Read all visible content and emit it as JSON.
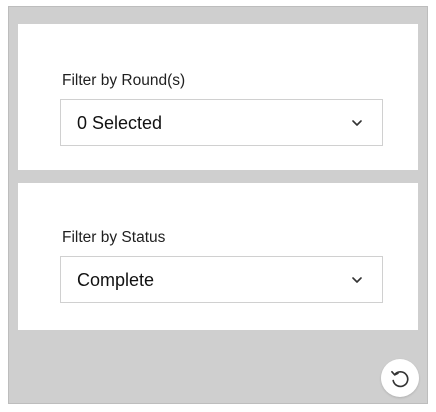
{
  "filters": {
    "round": {
      "label": "Filter by Round(s)",
      "value": "0 Selected",
      "icon": "chevron-down-icon"
    },
    "status": {
      "label": "Filter by Status",
      "value": "Complete",
      "icon": "chevron-down-icon"
    }
  },
  "reset": {
    "icon": "reset-icon"
  },
  "colors": {
    "panel_background": "#cfcfcf",
    "card_background": "#ffffff",
    "text": "#111111"
  }
}
